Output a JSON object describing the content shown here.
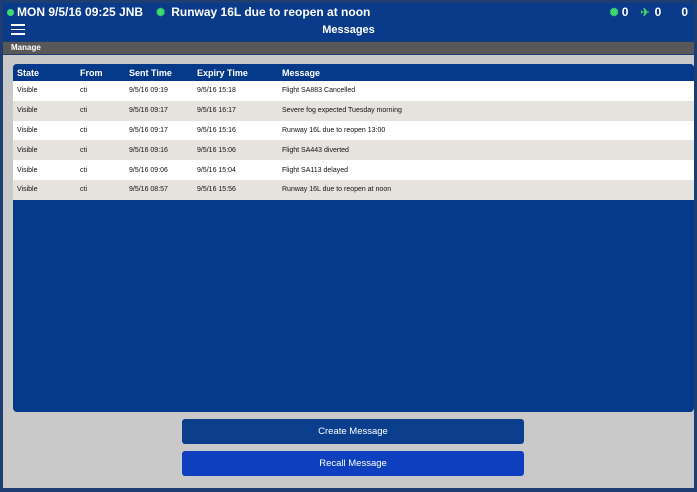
{
  "status_bar": {
    "datetime": "MON 9/5/16 09:25 JNB",
    "ticker": "Runway 16L due to reopen at noon",
    "counter1": "0",
    "counter2": "0",
    "counter3": "0"
  },
  "nav": {
    "title": "Messages"
  },
  "section": {
    "label": "Manage"
  },
  "table": {
    "headers": {
      "state": "State",
      "from": "From",
      "sent_time": "Sent Time",
      "expiry_time": "Expiry Time",
      "message": "Message"
    },
    "rows": [
      {
        "state": "Visible",
        "from": "cti",
        "sent": "9/5/16 09:19",
        "expiry": "9/5/16 15:18",
        "message": "Flight SA883 Cancelled"
      },
      {
        "state": "Visible",
        "from": "cti",
        "sent": "9/5/16 09:17",
        "expiry": "9/5/16 16:17",
        "message": "Severe fog expected Tuesday morning"
      },
      {
        "state": "Visible",
        "from": "cti",
        "sent": "9/5/16 09:17",
        "expiry": "9/5/16 15:16",
        "message": "Runway 16L due to reopen 13:00"
      },
      {
        "state": "Visible",
        "from": "cti",
        "sent": "9/5/16 09:16",
        "expiry": "9/5/16 15:06",
        "message": "Flight SA443 diverted"
      },
      {
        "state": "Visible",
        "from": "cti",
        "sent": "9/5/16 09:06",
        "expiry": "9/5/16 15:04",
        "message": "Flight SA113 delayed"
      },
      {
        "state": "Visible",
        "from": "cti",
        "sent": "9/5/16 08:57",
        "expiry": "9/5/16 15:56",
        "message": "Runway 16L due to reopen at noon"
      }
    ]
  },
  "buttons": {
    "create": "Create Message",
    "recall": "Recall Message"
  },
  "colors": {
    "accent_blue": "#053a8a",
    "status_green": "#3ddc6b"
  }
}
